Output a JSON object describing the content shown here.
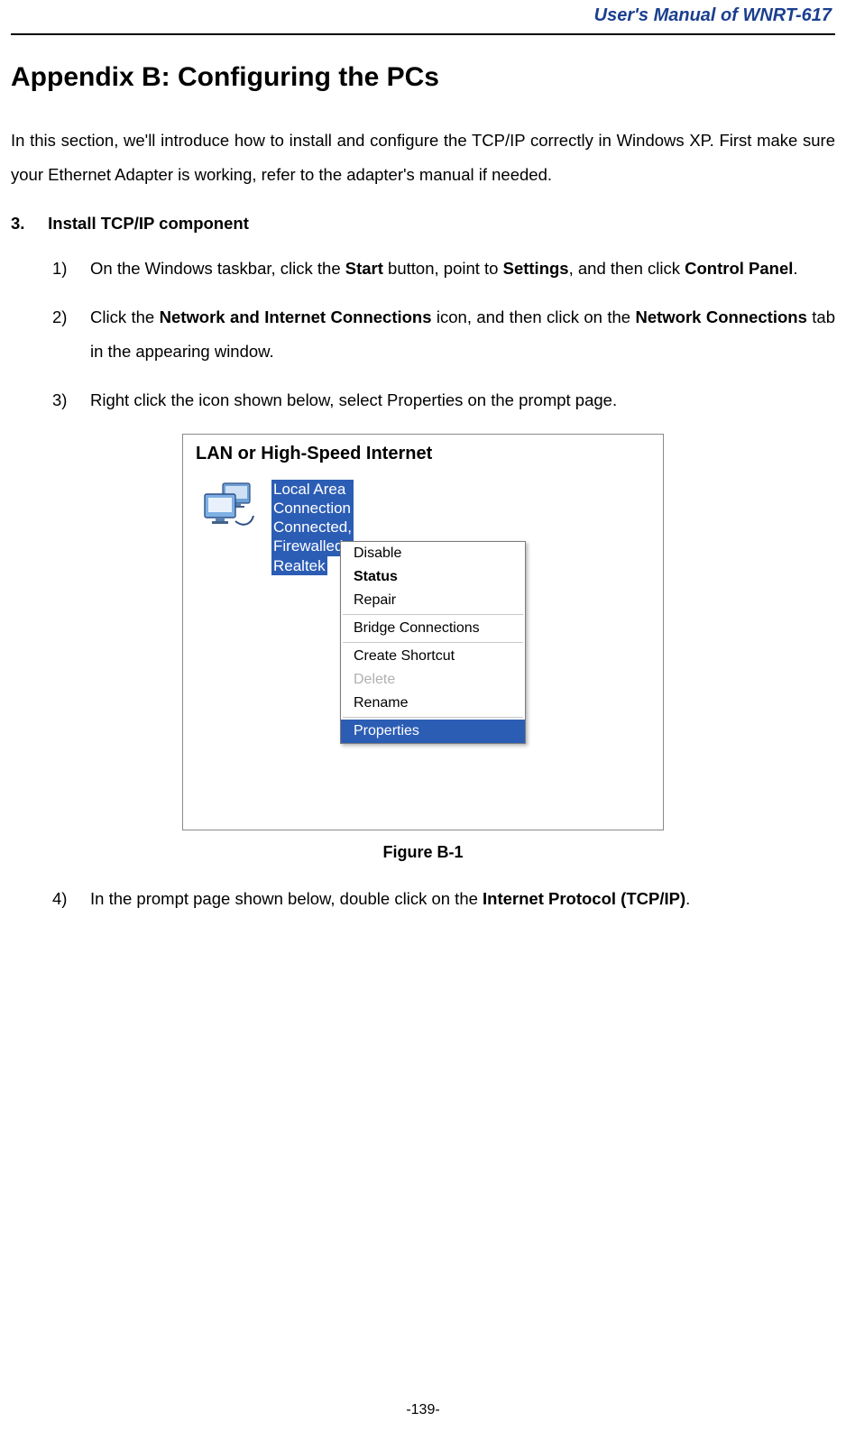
{
  "header": {
    "title": "User's Manual of WNRT-617"
  },
  "appendix": {
    "title": "Appendix B: Configuring the PCs",
    "intro": "In this section, we'll introduce how to install and configure the TCP/IP correctly in Windows XP. First make sure your Ethernet Adapter is working, refer to the adapter's manual if needed."
  },
  "section": {
    "num": "3.",
    "title": "Install TCP/IP component"
  },
  "steps": {
    "s1": {
      "num": "1)",
      "pre": "On the Windows taskbar, click the ",
      "b1": "Start",
      "mid1": " button, point to ",
      "b2": "Settings",
      "mid2": ", and then click ",
      "b3": "Control Panel",
      "post": "."
    },
    "s2": {
      "num": "2)",
      "pre": "Click the ",
      "b1": "Network and Internet Connections",
      "mid1": " icon, and then click on the ",
      "b2": "Network Connections",
      "post": " tab in the appearing window."
    },
    "s3": {
      "num": "3)",
      "text": "Right click the icon shown below, select Properties on the prompt page."
    },
    "s4": {
      "num": "4)",
      "pre": "In the prompt page shown below, double click on the ",
      "b1": "Internet Protocol (TCP/IP)",
      "post": "."
    }
  },
  "figure": {
    "section_title": "LAN or High-Speed Internet",
    "conn_name": "Local Area Connection",
    "conn_status": "Connected, Firewalled",
    "conn_adapter": "Realtek",
    "menu": {
      "disable": "Disable",
      "status": "Status",
      "repair": "Repair",
      "bridge": "Bridge Connections",
      "shortcut": "Create Shortcut",
      "delete": "Delete",
      "rename": "Rename",
      "properties": "Properties"
    },
    "caption": "Figure B-1"
  },
  "page_number": "-139-"
}
